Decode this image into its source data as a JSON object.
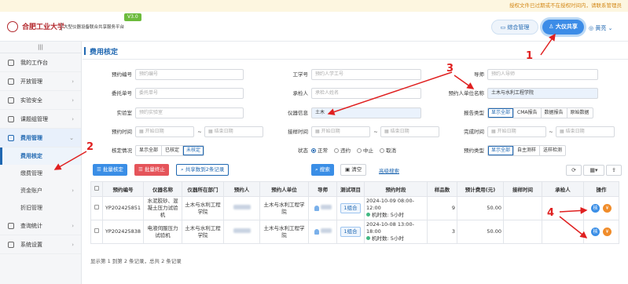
{
  "banner": "授权文件已过期或不在授权时间内，请联系管理员",
  "header": {
    "logo_text": "合肥工业大学",
    "platform_title": "大型仪器设备联合共享服务平台",
    "version": "V3.0",
    "btn_manage": "综合管理",
    "btn_share": "大仪共享",
    "user_name": "黄亮"
  },
  "sidebar": {
    "collapse": "|||",
    "items": [
      {
        "label": "我的工作台"
      },
      {
        "label": "开放管理"
      },
      {
        "label": "实验安全"
      },
      {
        "label": "课题组管理"
      },
      {
        "label": "费用管理"
      }
    ],
    "sub_items": [
      {
        "label": "费用核定"
      },
      {
        "label": "缴费管理"
      },
      {
        "label": "资金账户"
      },
      {
        "label": "折旧管理"
      }
    ],
    "items_bottom": [
      {
        "label": "查询统计"
      },
      {
        "label": "系统设置"
      }
    ]
  },
  "page_title": "费用核定",
  "form": {
    "booking_no_label": "预约编号",
    "booking_no_ph": "预约编号",
    "emp_no_label": "工学号",
    "emp_no_ph": "预约人学工号",
    "guide_label": "导师",
    "guide_ph": "预约人导师",
    "entrust_no_label": "委托单号",
    "entrust_no_ph": "委托单号",
    "contractor_label": "承检人",
    "contractor_ph": "承检人姓名",
    "unit_label": "预约人单位名称",
    "unit_value": "土木与水利工程学院",
    "lab_label": "实验室",
    "lab_ph": "预约实验室",
    "instrument_label": "仪器信息",
    "instrument_value": "土木",
    "report_label": "报告类型",
    "report_options": [
      "显示全部",
      "CMA报告",
      "数据报告",
      "原始数据"
    ],
    "booking_time_label": "预约时间",
    "receive_time_label": "接样时间",
    "finish_time_label": "完成时间",
    "start_ph": "开始日期",
    "end_ph": "结束日期",
    "tilde": "~",
    "approve_label": "核定情况",
    "approve_options": [
      "显示全部",
      "已核定",
      "未核定"
    ],
    "status_label": "状态",
    "status_options": [
      "正常",
      "违约",
      "中止",
      "取消"
    ],
    "booking_type_label": "预约类型",
    "booking_type_options": [
      "显示全部",
      "自主测样",
      "送样检测"
    ]
  },
  "actions": {
    "batch_audit": "批量核定",
    "batch_stop": "批量终止",
    "share_records": "共享数到2条记录",
    "search": "搜索",
    "clear": "清空",
    "advanced": "高级搜索"
  },
  "table": {
    "headers": [
      "",
      "预约编号",
      "仪器名称",
      "仪器所在部门",
      "预约人",
      "预约人单位",
      "导师",
      "测试项目",
      "预约时段",
      "样品数",
      "预计费用(元)",
      "接样时间",
      "承检人",
      "操作"
    ],
    "rows": [
      {
        "booking_no": "YP202425851",
        "instrument": "水泥胶砂、混凝土压力试验机",
        "dept": "土木与水利工程学院",
        "unit": "土木与水利工程学院",
        "project": "1组合",
        "period": "2024-10-09 08:00-12:00",
        "duration": "机时数: 5小时",
        "samples": "9",
        "fee": "50.00",
        "op1": "核",
        "op2": "¥"
      },
      {
        "booking_no": "YP202425838",
        "instrument": "电液伺服压力试验机",
        "dept": "土木与水利工程学院",
        "unit": "土木与水利工程学院",
        "project": "1组合",
        "period": "2024-10-08 13:00-18:00",
        "duration": "机时数: 5小时",
        "samples": "3",
        "fee": "50.00",
        "op1": "核",
        "op2": "¥"
      }
    ]
  },
  "summary": "显示第 1 到第 2 条记录，总共 2 条记录",
  "annotations": [
    "1",
    "2",
    "3",
    "4"
  ],
  "colors": {
    "primary": "#1f67b1",
    "accent": "#3a8ee6",
    "danger": "#e5545a",
    "arrow": "#e02020"
  }
}
